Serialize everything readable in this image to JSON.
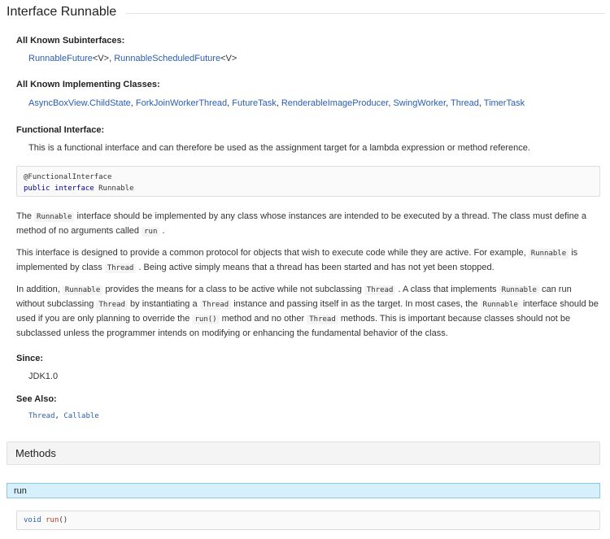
{
  "header": {
    "title": "Interface Runnable"
  },
  "subinterfaces": {
    "label": "All Known Subinterfaces:",
    "items": [
      {
        "name": "RunnableFuture",
        "generic": "<V>",
        "sep": ", "
      },
      {
        "name": "RunnableScheduledFuture",
        "generic": "<V>",
        "sep": ""
      }
    ]
  },
  "implementing": {
    "label": "All Known Implementing Classes:",
    "items": [
      "AsyncBoxView.ChildState",
      "ForkJoinWorkerThread",
      "FutureTask",
      "RenderableImageProducer",
      "SwingWorker",
      "Thread",
      "TimerTask"
    ]
  },
  "functional": {
    "label": "Functional Interface:",
    "text": "This is a functional interface and can therefore be used as the assignment target for a lambda expression or method reference."
  },
  "signature": {
    "annotation": "@FunctionalInterface",
    "kw_public": "public",
    "kw_interface": "interface",
    "name": "Runnable"
  },
  "description": {
    "p1": {
      "t1": "The",
      "c1": "Runnable",
      "t2": "interface should be implemented by any class whose instances are intended to be executed by a thread. The class must define a method of no arguments called",
      "c2": "run",
      "t3": "."
    },
    "p2": {
      "t1": "This interface is designed to provide a common protocol for objects that wish to execute code while they are active. For example,",
      "c1": "Runnable",
      "t2": "is implemented by class",
      "c2": "Thread",
      "t3": ". Being active simply means that a thread has been started and has not yet been stopped."
    },
    "p3": {
      "t1": "In addition,",
      "c1": "Runnable",
      "t2": "provides the means for a class to be active while not subclassing",
      "c2": "Thread",
      "t3": ". A class that implements",
      "c3": "Runnable",
      "t4": "can run without subclassing",
      "c4": "Thread",
      "t5": "by instantiating a",
      "c5": "Thread",
      "t6": "instance and passing itself in as the target. In most cases, the",
      "c6": "Runnable",
      "t7": "interface should be used if you are only planning to override the",
      "c7": "run()",
      "t8": "method and no other",
      "c8": "Thread",
      "t9": "methods. This is important because classes should not be subclassed unless the programmer intends on modifying or enhancing the fundamental behavior of the class."
    }
  },
  "since": {
    "label": "Since:",
    "value": "JDK1.0"
  },
  "see_also": {
    "label": "See Also:",
    "links": [
      "Thread",
      "Callable"
    ],
    "sep": ", "
  },
  "methods": {
    "header": "Methods",
    "run": {
      "name": "run",
      "sig_type": "void",
      "sig_name": "run",
      "sig_parens": "()"
    }
  }
}
